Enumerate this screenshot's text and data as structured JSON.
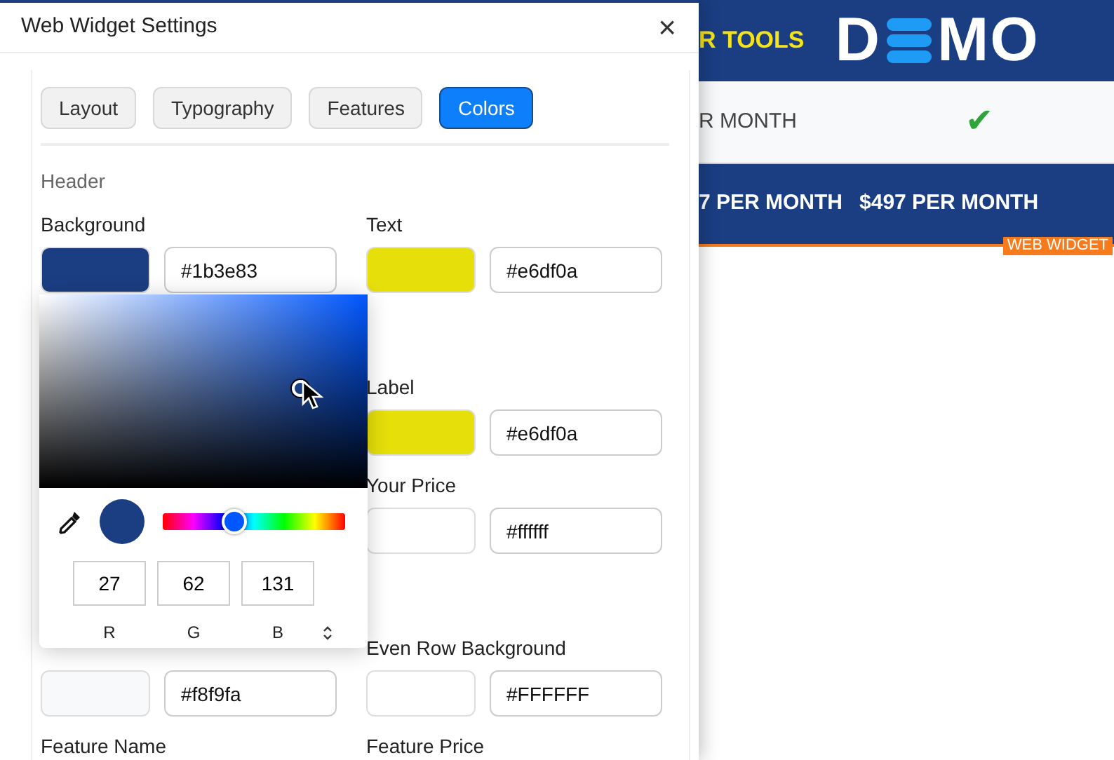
{
  "page_behind": {
    "header_text": "R TOOLS",
    "logo_left": "D",
    "logo_right": "MO",
    "row_text": "R MONTH",
    "check": "✔",
    "prices": [
      "7 PER MONTH",
      "$497 PER MONTH"
    ],
    "badge": "WEB WIDGET"
  },
  "dialog": {
    "title": "Web Widget Settings",
    "close": "×",
    "tabs": [
      {
        "label": "Layout",
        "selected": false
      },
      {
        "label": "Typography",
        "selected": false
      },
      {
        "label": "Features",
        "selected": false
      },
      {
        "label": "Colors",
        "selected": true
      }
    ],
    "sections": [
      {
        "heading": "Header",
        "rows": [
          {
            "left": {
              "label": "Background",
              "value": "#1b3e83"
            },
            "right": {
              "label": "Text",
              "value": "#e6df0a"
            }
          }
        ]
      },
      {
        "rows": [
          {
            "right": {
              "label": "Label",
              "value": "#e6df0a"
            }
          },
          {
            "right": {
              "label": "Your Price",
              "value": "#ffffff"
            }
          }
        ]
      },
      {
        "rows": [
          {
            "left": {
              "value": "#f8f9fa"
            },
            "right": {
              "label": "Even Row Background",
              "value": "#FFFFFF"
            }
          },
          {
            "left": {
              "label": "Feature Name"
            },
            "right": {
              "label": "Feature Price"
            }
          }
        ]
      }
    ]
  },
  "color_picker": {
    "hue_slider": {
      "level": 0.39
    },
    "rgb": [
      "27",
      "62",
      "131"
    ],
    "channel_labels": [
      "R",
      "G",
      "B"
    ]
  }
}
